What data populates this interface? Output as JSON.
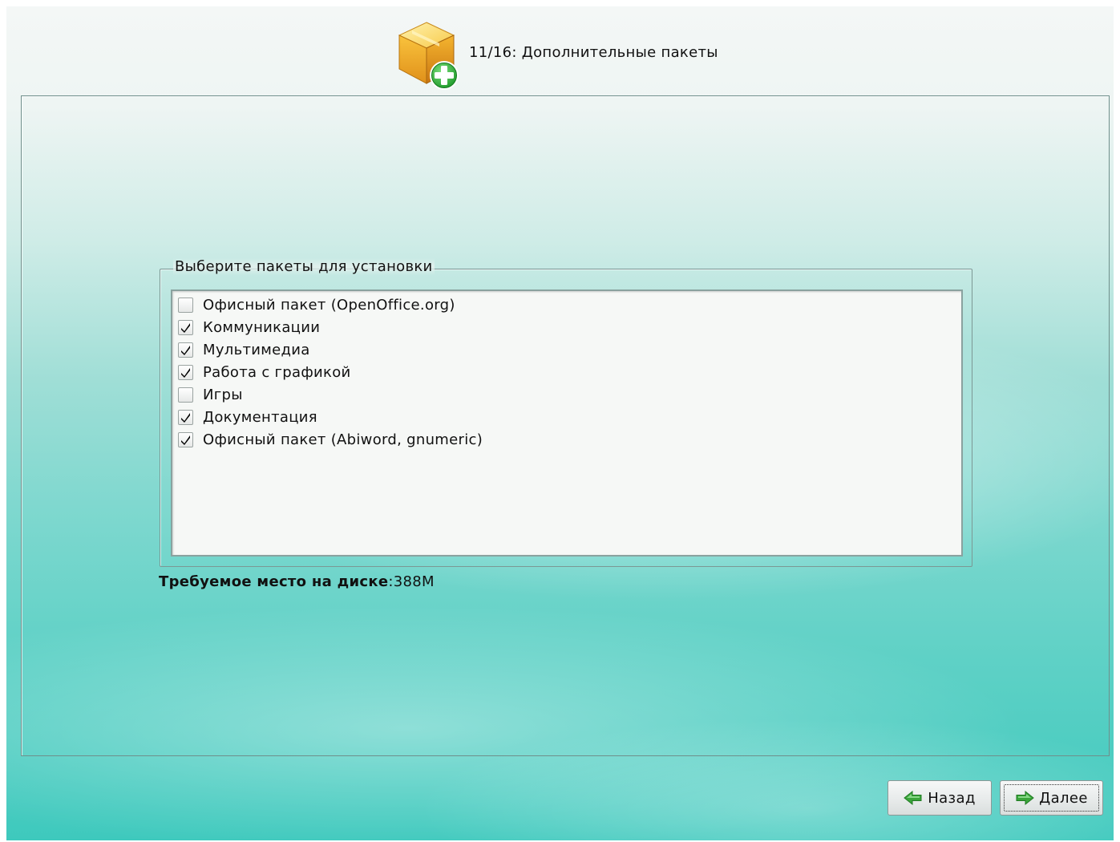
{
  "header": {
    "step_title": "11/16: Дополнительные пакеты",
    "icon": "package-add-icon"
  },
  "package_group": {
    "legend": "Выберите пакеты для установки",
    "items": [
      {
        "label": "Офисный пакет (OpenOffice.org)",
        "checked": false
      },
      {
        "label": "Коммуникации",
        "checked": true
      },
      {
        "label": "Мультимедиа",
        "checked": true
      },
      {
        "label": "Работа с графикой",
        "checked": true
      },
      {
        "label": "Игры",
        "checked": false
      },
      {
        "label": "Документация",
        "checked": true
      },
      {
        "label": "Офисный пакет (Abiword, gnumeric)",
        "checked": true
      }
    ]
  },
  "disk_space": {
    "label": "Требуемое место на диске",
    "value": ":388M"
  },
  "buttons": {
    "back_label": "Назад",
    "back_icon": "arrow-left-icon",
    "next_label": "Далее",
    "next_icon": "arrow-right-icon"
  },
  "colors": {
    "arrow_green": "#3aa53a",
    "background_teal": "#3ec9bd"
  }
}
